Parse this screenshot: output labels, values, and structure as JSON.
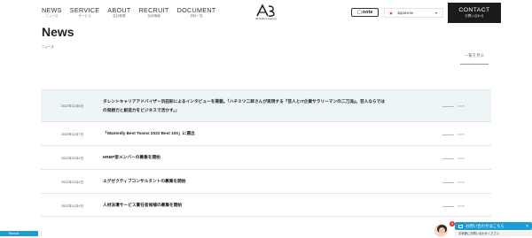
{
  "header": {
    "nav": [
      {
        "en": "NEWS",
        "jp": "ニュース"
      },
      {
        "en": "SERVICE",
        "jp": "サービス"
      },
      {
        "en": "ABOUT",
        "jp": "会社概要"
      },
      {
        "en": "RECRUIT",
        "jp": "採用情報"
      },
      {
        "en": "DOCUMENT",
        "jp": "資料一覧"
      }
    ],
    "logo_sub": "All Sellers Agency",
    "note_label": "note",
    "language": "Japanese",
    "contact_en": "CONTACT",
    "contact_jp": "お問い合わせ"
  },
  "page": {
    "title": "News",
    "subtitle": "ニュース",
    "back_link": "一覧を見る"
  },
  "news": [
    {
      "date": "2022年11月8日",
      "title": "タレントキャリアアドバイザー浜田彩によるインタビューを掲載。「ハチミツ二郎さんが実現する『芸人とIT企業サラリーマンの二刀流』。芸人ならではの発想力と創造力をビジネスで活かす。」",
      "more": "more"
    },
    {
      "date": "2022年11月7日",
      "title": "「Wantedly Best Teams 2022 Best 100」に選出",
      "more": "more"
    },
    {
      "date": "2022年11月4日",
      "title": "HRBP室メンバーの募集を開始",
      "more": "more"
    },
    {
      "date": "2022年11月4日",
      "title": "エグゼクティブコンサルタントの募集を開始",
      "more": "more"
    },
    {
      "date": "2022年11月4日",
      "title": "人材派遣サービス責任者候補の募集を開始",
      "more": "more"
    }
  ],
  "bottom_tab": "Recruit",
  "chat": {
    "badge": "1",
    "label": "お問い合わせはこちら",
    "close": "×",
    "sub": "お気軽にお問い合わせください"
  },
  "colors": {
    "accent": "#1d9bd6",
    "dark": "#1b1b1b",
    "highlight_row": "#eef5f7"
  }
}
